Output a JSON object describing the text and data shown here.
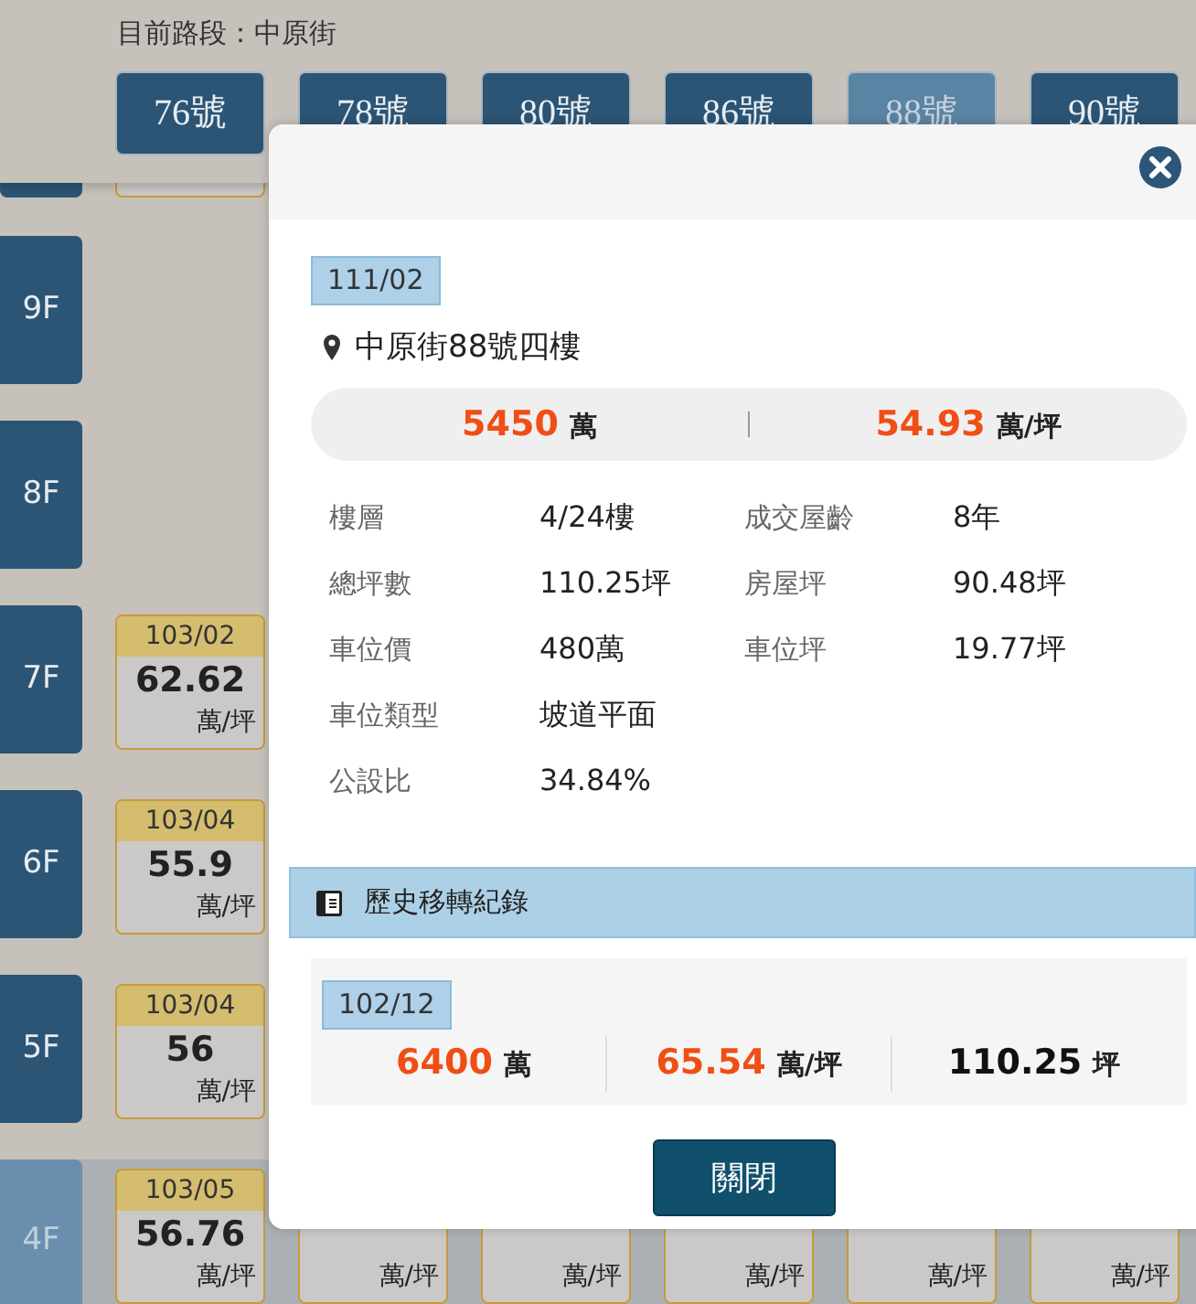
{
  "route": {
    "label": "目前路段：中原街"
  },
  "buildings": [
    {
      "label": "76號",
      "selected": false
    },
    {
      "label": "78號",
      "selected": false
    },
    {
      "label": "80號",
      "selected": false
    },
    {
      "label": "86號",
      "selected": false
    },
    {
      "label": "88號",
      "selected": true
    },
    {
      "label": "90號",
      "selected": false
    }
  ],
  "floors": [
    {
      "label": "9F",
      "selected": false
    },
    {
      "label": "8F",
      "selected": false
    },
    {
      "label": "7F",
      "selected": false,
      "cards": [
        {
          "date": "103/02",
          "price": "62.62",
          "unit": "萬/坪"
        }
      ]
    },
    {
      "label": "6F",
      "selected": false,
      "cards": [
        {
          "date": "103/04",
          "price": "55.9",
          "unit": "萬/坪"
        }
      ]
    },
    {
      "label": "5F",
      "selected": false,
      "cards": [
        {
          "date": "103/04",
          "price": "56",
          "unit": "萬/坪"
        }
      ]
    },
    {
      "label": "4F",
      "selected": true,
      "cards": [
        {
          "date": "103/05",
          "price": "56.76",
          "unit": "萬/坪"
        },
        {
          "unit": "萬/坪"
        },
        {
          "unit": "萬/坪"
        },
        {
          "unit": "萬/坪"
        },
        {
          "unit": "萬/坪"
        },
        {
          "unit": "萬/坪"
        }
      ]
    }
  ],
  "modal": {
    "date": "111/02",
    "address": "中原街88號四樓",
    "summary": [
      {
        "value": "5450",
        "unit": "萬"
      },
      {
        "value": "54.93",
        "unit": "萬/坪"
      }
    ],
    "details": [
      {
        "items": [
          {
            "label": "樓層",
            "value": "4/24樓"
          },
          {
            "label": "成交屋齡",
            "value": "8年"
          }
        ]
      },
      {
        "items": [
          {
            "label": "總坪數",
            "value": "110.25坪"
          },
          {
            "label": "房屋坪",
            "value": "90.48坪"
          }
        ]
      },
      {
        "items": [
          {
            "label": "車位價",
            "value": "480萬"
          },
          {
            "label": "車位坪",
            "value": "19.77坪"
          }
        ]
      },
      {
        "items": [
          {
            "label": "車位類型",
            "value": "坡道平面"
          }
        ]
      },
      {
        "items": [
          {
            "label": "公設比",
            "value": "34.84%"
          }
        ]
      }
    ],
    "history_title": "歷史移轉紀錄",
    "history": [
      {
        "date": "102/12",
        "values": [
          {
            "value": "6400",
            "unit": "萬",
            "kind": "price"
          },
          {
            "value": "65.54",
            "unit": "萬/坪",
            "kind": "price"
          },
          {
            "value": "110.25",
            "unit": "坪",
            "kind": "area"
          }
        ]
      }
    ],
    "close_button": "關閉"
  }
}
